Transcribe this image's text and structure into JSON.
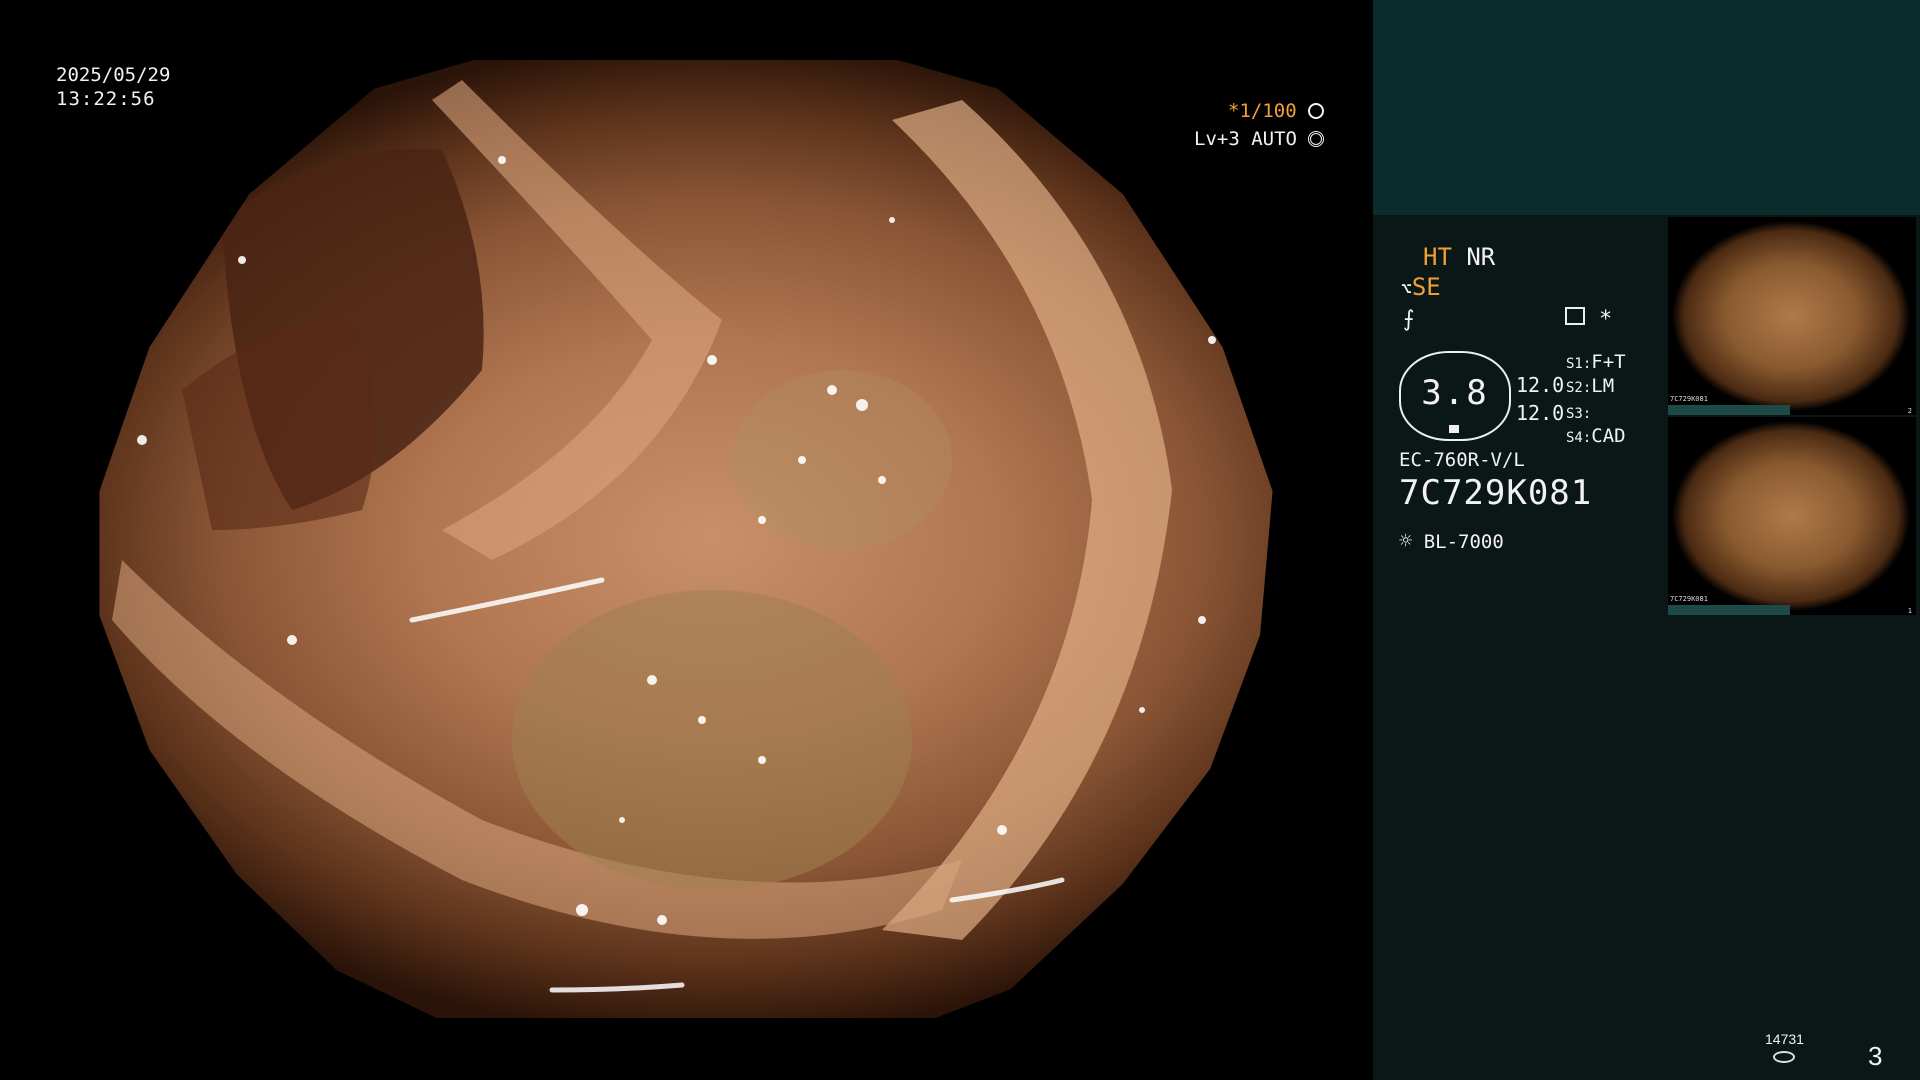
{
  "datetime": {
    "date": "2025/05/29",
    "time": "13:22:56"
  },
  "image_settings": {
    "shutter": "*1/100",
    "enhance": "Lv+3 AUTO"
  },
  "panel": {
    "ht": "HT",
    "nr": "NR",
    "se": "SE",
    "zoom": "3.8",
    "val1": "12.0",
    "val2": "12.0",
    "s1_key": "S1:",
    "s1_val": "F+T",
    "s2_key": "S2:",
    "s2_val": "LM",
    "s3_key": "S3:",
    "s3_val": "",
    "s4_key": "S4:",
    "s4_val": "CAD",
    "scope_model": "EC-760R-V/L",
    "serial": "7C729K081",
    "light_source": "BL-7000",
    "asterisk": "*"
  },
  "thumbnails": [
    {
      "label": "7C729K081",
      "index": "2"
    },
    {
      "label": "7C729K081",
      "index": "1"
    }
  ],
  "footer": {
    "count": "14731",
    "page": "3"
  },
  "colors": {
    "accent": "#f0a030",
    "panel_top": "#0b2c2c",
    "panel_body": "#0a1716"
  },
  "icons": [
    "shutter-icon",
    "enhance-icon",
    "se-icon",
    "sharpness-icon",
    "record-icon",
    "lamp-icon",
    "storage-icon"
  ]
}
